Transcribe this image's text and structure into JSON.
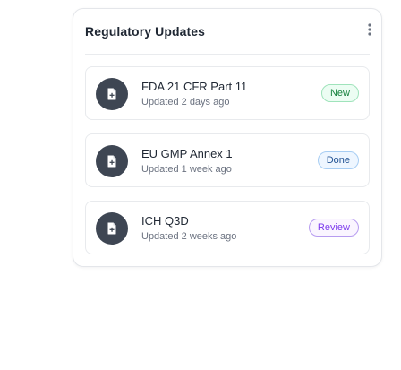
{
  "card": {
    "title": "Regulatory Updates",
    "menu_icon": "more-vertical-icon"
  },
  "colors": {
    "icon_background": "#3e4653",
    "new_badge": "#15803d",
    "done_badge": "#1d4f91",
    "review_badge": "#7c3aed"
  },
  "items": [
    {
      "title": "FDA 21 CFR Part 11",
      "updated": "Updated 2 days ago",
      "status": "New",
      "icon": "document-plus-icon"
    },
    {
      "title": "EU GMP Annex 1",
      "updated": "Updated 1 week ago",
      "status": "Done",
      "icon": "document-plus-icon"
    },
    {
      "title": "ICH Q3D",
      "updated": "Updated 2 weeks ago",
      "status": "Review",
      "icon": "document-plus-icon"
    }
  ]
}
